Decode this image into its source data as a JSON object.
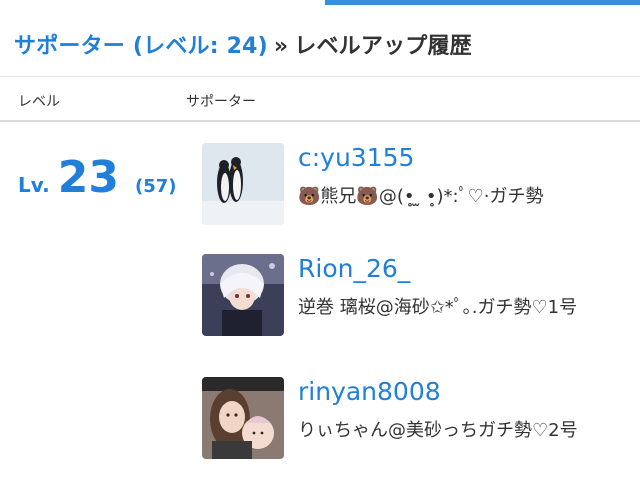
{
  "header": {
    "crumb_link": "サポーター (レベル: 24)",
    "separator": "»",
    "current": "レベルアップ履歴"
  },
  "columns": {
    "level": "レベル",
    "supporter": "サポーター"
  },
  "level_entry": {
    "prefix": "Lv.",
    "number": "23",
    "count": "(57)"
  },
  "supporters": [
    {
      "name": "c:yu3155",
      "bio": "🐻熊兄🐻@(•̥ ̫ •̥)*:ﾟ♡·ガチ勢",
      "avatar": "penguin-avatar"
    },
    {
      "name": "Rion_26_",
      "bio": "逆巻 璃桜@海砂✩*ﾟ｡.ガチ勢♡1号",
      "avatar": "anime-character-avatar"
    },
    {
      "name": "rinyan8008",
      "bio": "りぃちゃん@美砂っちガチ勢♡2号",
      "avatar": "selfie-avatar"
    }
  ],
  "colors": {
    "link_blue": "#1f7fd9",
    "text": "#333333",
    "divider": "#d9d9d9"
  }
}
